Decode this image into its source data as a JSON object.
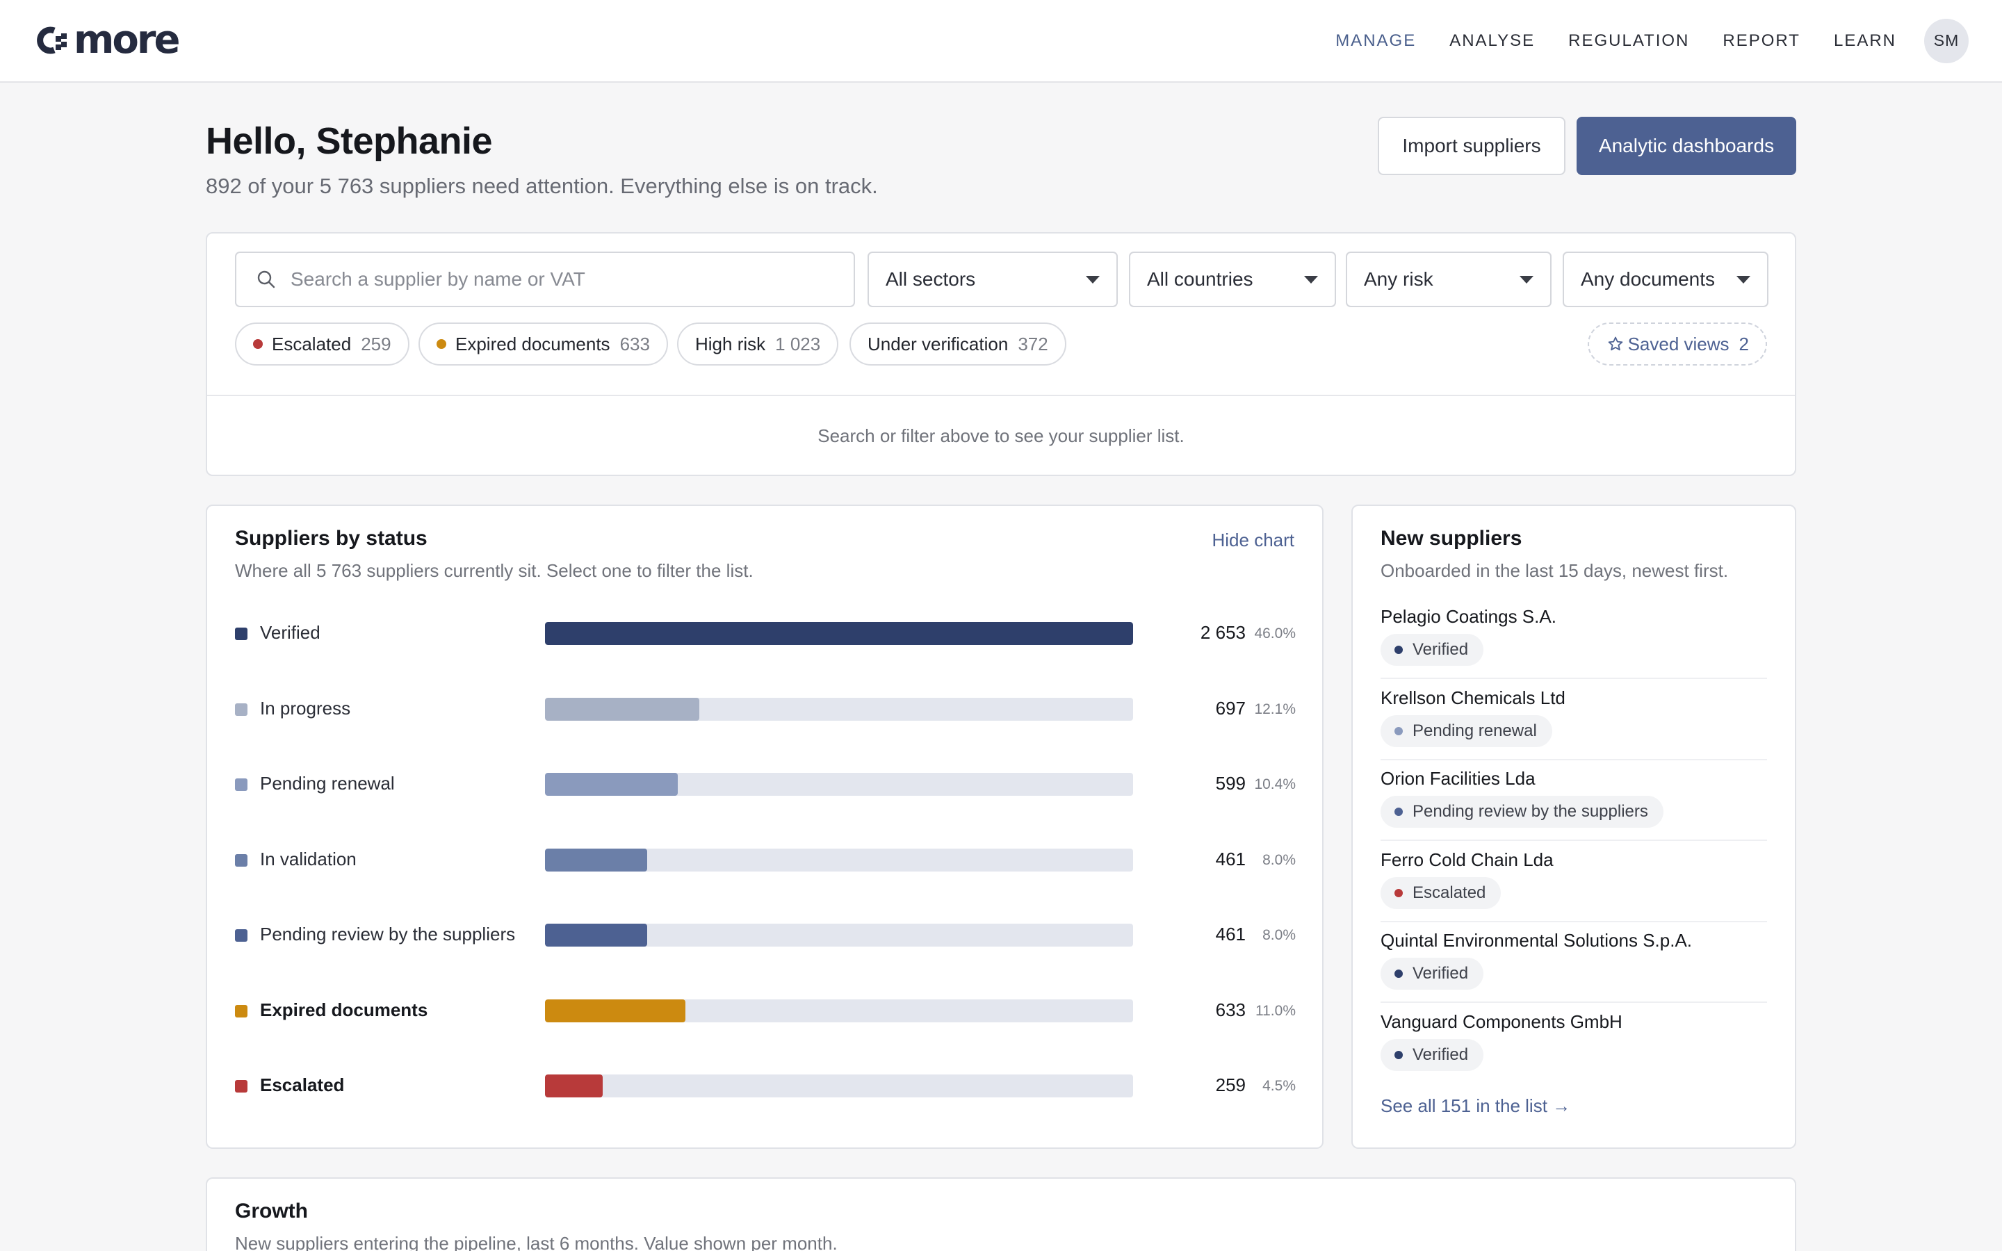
{
  "header": {
    "logo_text": "more",
    "nav": [
      "MANAGE",
      "ANALYSE",
      "REGULATION",
      "REPORT",
      "LEARN"
    ],
    "active_nav": "MANAGE",
    "avatar_initials": "SM"
  },
  "page": {
    "greeting": "Hello, Stephanie",
    "summary": "892 of your 5 763 suppliers need attention. Everything else is on track.",
    "import_button": "Import suppliers",
    "dashboards_button": "Analytic dashboards"
  },
  "filters": {
    "search_placeholder": "Search a supplier by name or VAT",
    "sector": "All sectors",
    "country": "All countries",
    "risk": "Any risk",
    "documents": "Any documents",
    "chips": [
      {
        "label": "Escalated",
        "count": "259",
        "dot_color": "#b83a3a"
      },
      {
        "label": "Expired documents",
        "count": "633",
        "dot_color": "#cc8a10"
      },
      {
        "label": "High risk",
        "count": "1 023"
      },
      {
        "label": "Under verification",
        "count": "372"
      }
    ],
    "saved_views": {
      "label": "Saved views",
      "count": "2",
      "icon": "star-outline-icon"
    },
    "hint": "Search or filter above to see your supplier list."
  },
  "status_chart": {
    "title": "Suppliers by status",
    "subtitle": "Where all 5 763 suppliers currently sit. Select one to filter the list.",
    "hide_label": "Hide chart",
    "chart_data": {
      "type": "bar",
      "orientation": "horizontal",
      "total": 5763,
      "categories": [
        "Verified",
        "In progress",
        "Pending renewal",
        "In validation",
        "Pending review by the suppliers",
        "Expired documents",
        "Escalated"
      ],
      "values": [
        2653,
        697,
        599,
        461,
        461,
        633,
        259
      ],
      "value_labels": [
        "2 653",
        "697",
        "599",
        "461",
        "461",
        "633",
        "259"
      ],
      "percent_labels": [
        "46.0%",
        "12.1%",
        "10.4%",
        "8.0%",
        "8.0%",
        "11.0%",
        "4.5%"
      ],
      "colors": [
        "#2e3f6b",
        "#a7b1c5",
        "#8a9abd",
        "#6b7fa8",
        "#4d6192",
        "#cc8a10",
        "#b83a3a"
      ],
      "bold": [
        false,
        false,
        false,
        false,
        false,
        true,
        true
      ]
    }
  },
  "new_suppliers": {
    "title": "New suppliers",
    "subtitle": "Onboarded in the last 15 days, newest first.",
    "items": [
      {
        "name": "Pelagio Coatings S.A.",
        "status": "Verified",
        "dot_color": "#2e3f6b"
      },
      {
        "name": "Krellson Chemicals Ltd",
        "status": "Pending renewal",
        "dot_color": "#8a9abd"
      },
      {
        "name": "Orion Facilities Lda",
        "status": "Pending review by the suppliers",
        "dot_color": "#4d6192"
      },
      {
        "name": "Ferro Cold Chain Lda",
        "status": "Escalated",
        "dot_color": "#b83a3a"
      },
      {
        "name": "Quintal Environmental Solutions S.p.A.",
        "status": "Verified",
        "dot_color": "#2e3f6b"
      },
      {
        "name": "Vanguard Components GmbH",
        "status": "Verified",
        "dot_color": "#2e3f6b"
      }
    ],
    "see_all": "See all 151 in the list →"
  },
  "growth": {
    "title": "Growth",
    "subtitle": "New suppliers entering the pipeline, last 6 months. Value shown per month."
  }
}
